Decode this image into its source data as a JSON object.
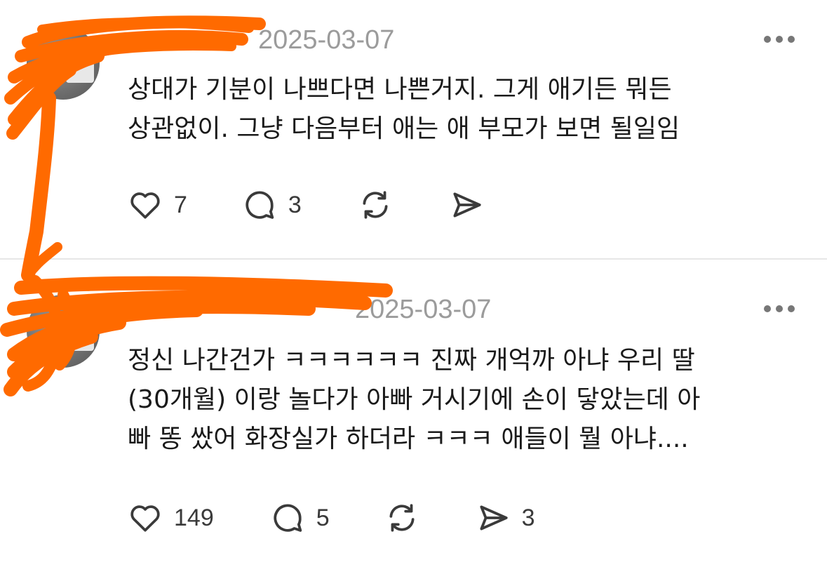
{
  "posts": [
    {
      "username": "",
      "timestamp": "2025-03-07",
      "body_lines": [
        "상대가 기분이 나쁘다면 나쁜거지. 그게 애기든 뭐든",
        "상관없이. 그냥 다음부터 애는 애 부모가 보면 될일임"
      ],
      "likes": "7",
      "replies": "3",
      "reposts": "",
      "shares": ""
    },
    {
      "username": "",
      "timestamp": "2025-03-07",
      "body_lines": [
        "정신 나간건가 ㅋㅋㅋㅋㅋㅋ 진짜 개억까 아냐 우리 딸",
        "(30개월) 이랑 놀다가 아빠 거시기에 손이 닿았는데 아",
        "빠 똥 쌌어 화장실가 하더라 ㅋㅋㅋ 애들이 뭘 아냐...."
      ],
      "likes": "149",
      "replies": "5",
      "reposts": "",
      "shares": "3"
    }
  ],
  "icons": {
    "like": "heart-icon",
    "reply": "comment-bubble-icon",
    "repost": "repost-arrows-icon",
    "share": "send-icon",
    "more": "more-dots-icon"
  },
  "colors": {
    "redaction": "#ff6a00",
    "timestamp": "#9b9b9b",
    "icon": "#3a3a3a"
  }
}
